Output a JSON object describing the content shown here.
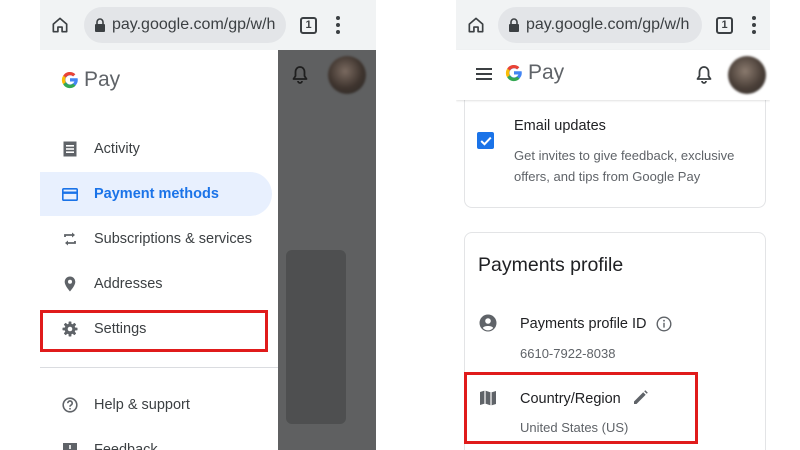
{
  "left_panel": {
    "browser": {
      "url": "pay.google.com/gp/w/h",
      "tab_count": "1"
    },
    "drawer": {
      "logo": {
        "g": "G",
        "pay": "Pay"
      },
      "items": [
        {
          "label": "Activity",
          "icon": "receipt-icon"
        },
        {
          "label": "Payment methods",
          "icon": "credit-card-icon",
          "active": true
        },
        {
          "label": "Subscriptions & services",
          "icon": "repeat-icon"
        },
        {
          "label": "Addresses",
          "icon": "location-pin-icon"
        },
        {
          "label": "Settings",
          "icon": "gear-icon",
          "highlighted": true
        },
        {
          "label": "Help & support",
          "icon": "help-icon"
        },
        {
          "label": "Feedback",
          "icon": "feedback-icon"
        }
      ]
    }
  },
  "right_panel": {
    "browser": {
      "url": "pay.google.com/gp/w/h",
      "tab_count": "1"
    },
    "header": {
      "logo": {
        "g": "G",
        "pay": "Pay"
      }
    },
    "email_updates": {
      "title": "Email updates",
      "description": "Get invites to give feedback, exclusive offers, and tips from Google Pay",
      "checked": true
    },
    "payments_profile": {
      "heading": "Payments profile",
      "profile_id_label": "Payments profile ID",
      "profile_id_value": "6610-7922-8038",
      "country_label": "Country/Region",
      "country_value": "United States (US)"
    }
  },
  "colors": {
    "accent_blue": "#1a73e8",
    "active_bg": "#e8f0fe",
    "highlight_red": "#e01b1b",
    "chrome_bar": "#f1f3f4",
    "scrim": "#5f6061"
  }
}
